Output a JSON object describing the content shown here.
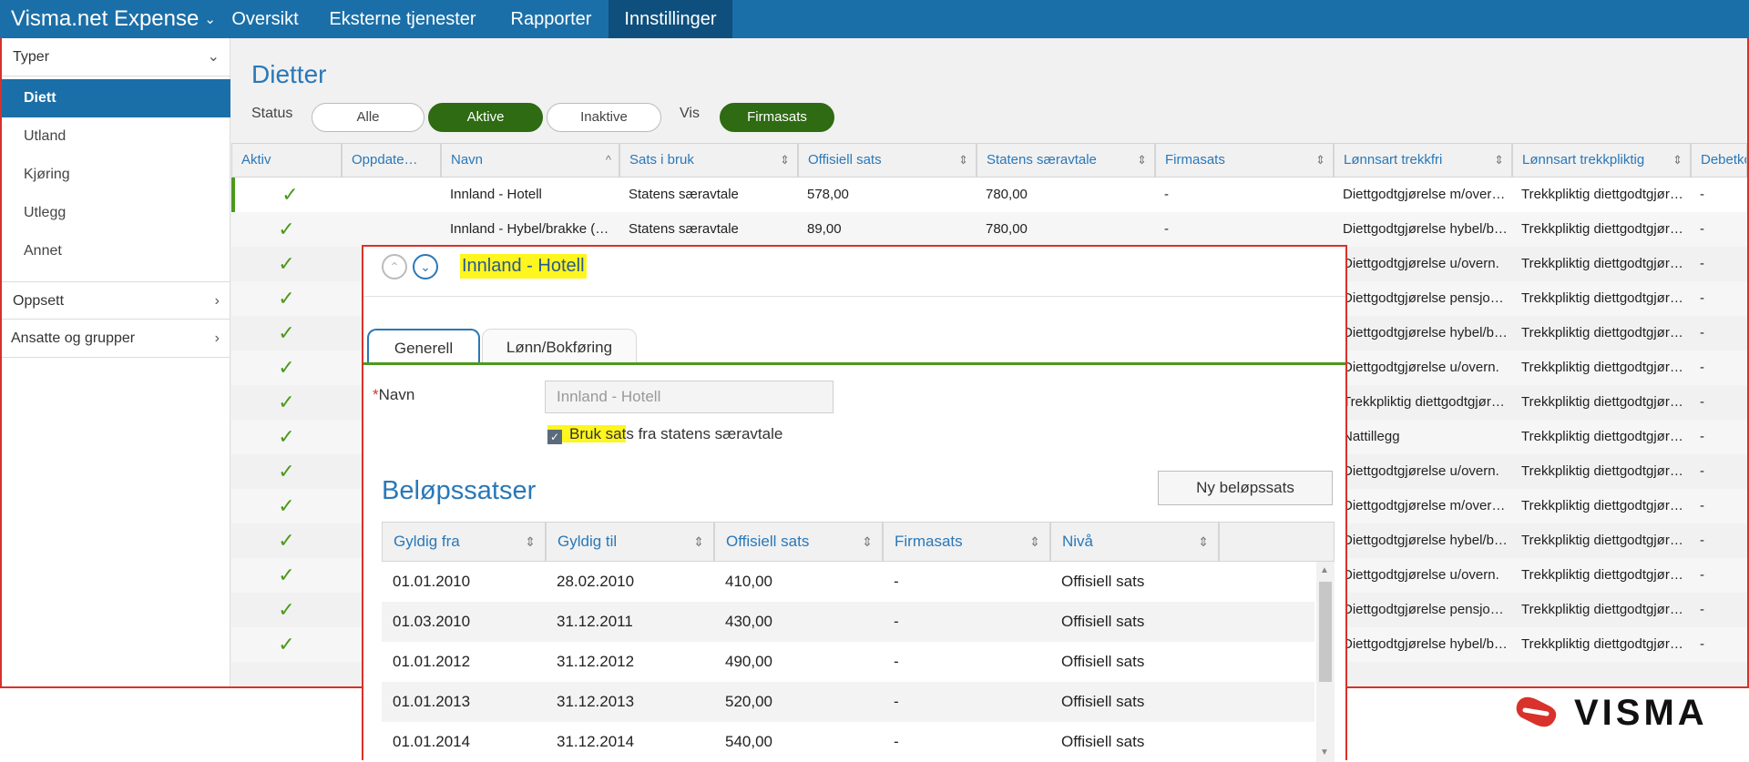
{
  "app": {
    "title": "Visma.net Expense",
    "logo_text": "VISMA"
  },
  "nav": [
    {
      "label": "Oversikt"
    },
    {
      "label": "Eksterne tjenester"
    },
    {
      "label": "Rapporter"
    },
    {
      "label": "Innstillinger",
      "active": true
    }
  ],
  "sidebar": {
    "group": "Typer",
    "items": [
      "Diett",
      "Utland",
      "Kjøring",
      "Utlegg",
      "Annet"
    ],
    "sections": [
      "Oppsett",
      "Ansatte og grupper"
    ]
  },
  "page": {
    "title": "Dietter"
  },
  "filters": {
    "status_label": "Status",
    "all": "Alle",
    "active": "Aktive",
    "inactive": "Inaktive",
    "vis_label": "Vis",
    "firmasats": "Firmasats"
  },
  "grid": {
    "columns": [
      "Aktiv",
      "Oppdate…",
      "Navn",
      "Sats i bruk",
      "Offisiell sats",
      "Statens særavtale",
      "Firmasats",
      "Lønnsart trekkfri",
      "Lønnsart trekkpliktig",
      "Debetko"
    ],
    "rows": [
      {
        "navn": "Innland - Hotell",
        "sats": "Statens særavtale",
        "offisiell": "578,00",
        "statens": "780,00",
        "firmasats": "-",
        "trekkfri": "Diettgodtgjørelse m/over…",
        "trekkpliktig": "Trekkpliktig diettgodtgjør…",
        "debet": "-"
      },
      {
        "navn": "Innland - Hybel/brakke (…",
        "sats": "Statens særavtale",
        "offisiell": "89,00",
        "statens": "780,00",
        "firmasats": "-",
        "trekkfri": "Diettgodtgjørelse hybel/b…",
        "trekkpliktig": "Trekkpliktig diettgodtgjør…",
        "debet": "-"
      },
      {
        "trekkfri": "Diettgodtgjørelse u/overn.",
        "trekkpliktig": "Trekkpliktig diettgodtgjør…",
        "debet": "-"
      },
      {
        "trekkfri": "Diettgodtgjørelse pensjo…",
        "trekkpliktig": "Trekkpliktig diettgodtgjør…",
        "debet": "-"
      },
      {
        "trekkfri": "Diettgodtgjørelse hybel/b…",
        "trekkpliktig": "Trekkpliktig diettgodtgjør…",
        "debet": "-"
      },
      {
        "trekkfri": "Diettgodtgjørelse u/overn.",
        "trekkpliktig": "Trekkpliktig diettgodtgjør…",
        "debet": "-"
      },
      {
        "trekkfri": "Trekkpliktig diettgodtgjør…",
        "trekkpliktig": "Trekkpliktig diettgodtgjør…",
        "debet": "-"
      },
      {
        "trekkfri": "Nattillegg",
        "trekkpliktig": "Trekkpliktig diettgodtgjør…",
        "debet": "-"
      },
      {
        "trekkfri": "Diettgodtgjørelse u/overn.",
        "trekkpliktig": "Trekkpliktig diettgodtgjør…",
        "debet": "-"
      },
      {
        "trekkfri": "Diettgodtgjørelse m/over…",
        "trekkpliktig": "Trekkpliktig diettgodtgjør…",
        "debet": "-"
      },
      {
        "trekkfri": "Diettgodtgjørelse hybel/b…",
        "trekkpliktig": "Trekkpliktig diettgodtgjør…",
        "debet": "-"
      },
      {
        "trekkfri": "Diettgodtgjørelse u/overn.",
        "trekkpliktig": "Trekkpliktig diettgodtgjør…",
        "debet": "-"
      },
      {
        "trekkfri": "Diettgodtgjørelse pensjo…",
        "trekkpliktig": "Trekkpliktig diettgodtgjør…",
        "debet": "-"
      },
      {
        "trekkfri": "Diettgodtgjørelse hybel/b…",
        "trekkpliktig": "Trekkpliktig diettgodtgjør…",
        "debet": "-"
      }
    ]
  },
  "popup": {
    "title": "Innland - Hotell",
    "tabs": [
      "Generell",
      "Lønn/Bokføring"
    ],
    "navn_label": "Navn",
    "required_mark": "*",
    "navn_value": "Innland - Hotell",
    "checkbox_label": "Bruk sats fra statens særavtale",
    "checkbox_checked": true,
    "section_title": "Beløpssatser",
    "new_button": "Ny beløpssats",
    "columns": [
      "Gyldig fra",
      "Gyldig til",
      "Offisiell sats",
      "Firmasats",
      "Nivå"
    ],
    "rows": [
      {
        "fra": "01.01.2010",
        "til": "28.02.2010",
        "offisiell": "410,00",
        "firmasats": "-",
        "niva": "Offisiell sats"
      },
      {
        "fra": "01.03.2010",
        "til": "31.12.2011",
        "offisiell": "430,00",
        "firmasats": "-",
        "niva": "Offisiell sats"
      },
      {
        "fra": "01.01.2012",
        "til": "31.12.2012",
        "offisiell": "490,00",
        "firmasats": "-",
        "niva": "Offisiell sats"
      },
      {
        "fra": "01.01.2013",
        "til": "31.12.2013",
        "offisiell": "520,00",
        "firmasats": "-",
        "niva": "Offisiell sats"
      },
      {
        "fra": "01.01.2014",
        "til": "31.12.2014",
        "offisiell": "540,00",
        "firmasats": "-",
        "niva": "Offisiell sats"
      }
    ]
  },
  "colors": {
    "brand": "#1b6fa8",
    "active_green": "#2e6b12",
    "check_green": "#4a9a1c",
    "highlight": "#fff51f",
    "annotation_red": "#d9312b"
  },
  "icons": [
    "chevron-down-icon",
    "chevron-right-icon",
    "sort-icon",
    "check-icon",
    "circle-up-icon",
    "circle-down-icon",
    "scroll-up-icon",
    "scroll-down-icon",
    "visma-logo-icon"
  ]
}
